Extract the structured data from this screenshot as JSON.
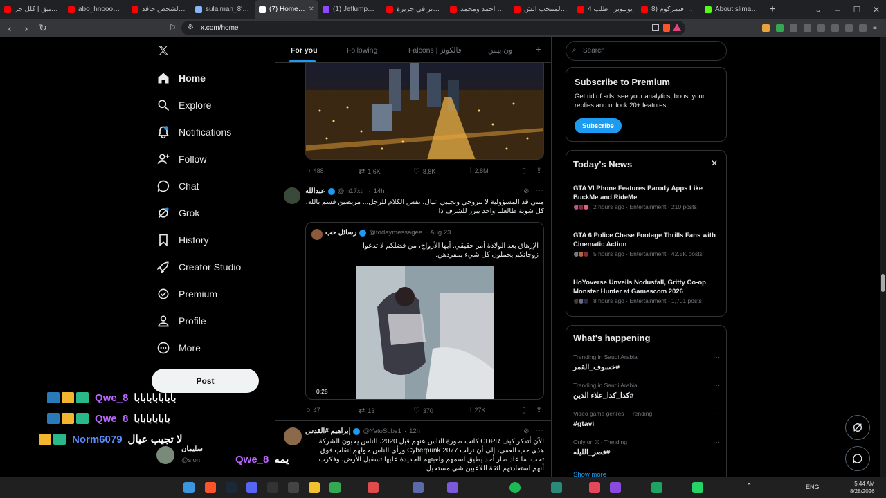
{
  "browser": {
    "tabs": [
      {
        "label": "انيوكستيق | كلل جر",
        "color": "#ff0000",
        "active": false
      },
      {
        "label": "abo_hnoood - Yo",
        "color": "#ff0000",
        "active": false
      },
      {
        "label": "هذا الشخص حاقد",
        "color": "#ff0000",
        "active": false
      },
      {
        "label": "sulaiman_8's Wa",
        "color": "#8ab4f8",
        "active": false
      },
      {
        "label": "(7) Home / X",
        "color": "#ffffff",
        "active": true
      },
      {
        "label": "(1) JeflumpLIVE",
        "color": "#9146ff",
        "active": false
      },
      {
        "label": "فالكونز في جزيرة",
        "color": "#ff0000",
        "active": false
      },
      {
        "label": "بث احمد ومحمد",
        "color": "#ff0000",
        "active": false
      },
      {
        "label": "منارة المنتخب الش",
        "color": "#ff0000",
        "active": false
      },
      {
        "label": "4 يوتيوبر | طلب",
        "color": "#ff0000",
        "active": false
      },
      {
        "label": "عرض فيمركوم (8",
        "color": "#ff0000",
        "active": false
      },
      {
        "label": "About sliman_8",
        "color": "#53fc18",
        "active": false
      }
    ],
    "url": "x.com/home"
  },
  "nav": {
    "items": [
      {
        "label": "Home",
        "icon": "home-icon",
        "bold": true
      },
      {
        "label": "Explore",
        "icon": "search-icon"
      },
      {
        "label": "Notifications",
        "icon": "bell-icon"
      },
      {
        "label": "Follow",
        "icon": "person-add-icon"
      },
      {
        "label": "Chat",
        "icon": "chat-icon"
      },
      {
        "label": "Grok",
        "icon": "grok-icon"
      },
      {
        "label": "History",
        "icon": "bookmark-icon"
      },
      {
        "label": "Creator Studio",
        "icon": "rocket-icon"
      },
      {
        "label": "Premium",
        "icon": "premium-icon"
      },
      {
        "label": "Profile",
        "icon": "person-icon"
      },
      {
        "label": "More",
        "icon": "more-circle-icon"
      }
    ],
    "post_label": "Post"
  },
  "feed": {
    "tabs": [
      "For you",
      "Following",
      "Falcons | فالكونز",
      "ون بيس"
    ],
    "tweet1": {
      "replies": "488",
      "retweets": "1.6K",
      "likes": "8.8K",
      "views": "2.8M"
    },
    "tweet2": {
      "name": "عبدالله",
      "handle": "@m17xtn",
      "time": "14h",
      "text": "متني قد المسؤولية لا تتزوجي وتجيبي عيال، نفس الكلام للرجل... مريضين قسم بالله، كل شوية طالعلنا واحد يبرر للشرف ذا",
      "quote": {
        "name": "رسائل حب",
        "handle": "@todaymessagee",
        "date": "Aug 23",
        "text": "الإرهاق بعد الولادة أمر حقيقي. أيها الأزواج، من فضلكم لا تدعوا زوجاتكم يحملون كل شيء بمفردهن.",
        "duration": "0:28"
      },
      "replies": "47",
      "retweets": "13",
      "likes": "370",
      "views": "27K"
    },
    "tweet3": {
      "name": "إبراهيم #القدس",
      "handle": "@YatoSubs1",
      "time": "12h",
      "text": "الآن أتذكر كيف CDPR كانت صورة الناس عنهم قبل 2020، الناس يحبون الشركة هذي حب العمى، إلى أن نزلت Cyberpunk 2077 ورأي الناس حولهم انقلب فوق تحت، ما عاد صار أحد يطيق اسمهم ولعبتهم الجديدة عليها تسفيل الأرض، وفكرت أنهم استعادتهم لثقة اللاعبين شي مستحيل"
    }
  },
  "search": {
    "placeholder": "Search"
  },
  "premium": {
    "title": "Subscribe to Premium",
    "body": "Get rid of ads, see your analytics, boost your replies and unlock 20+ features.",
    "button": "Subscribe"
  },
  "news": {
    "title": "Today's News",
    "items": [
      {
        "title": "GTA VI Phone Features Parody Apps Like BuckMe and RideMe",
        "meta": "2 hours ago · Entertainment · 210 posts"
      },
      {
        "title": "GTA 6 Police Chase Footage Thrills Fans with Cinematic Action",
        "meta": "5 hours ago · Entertainment · 42.5K posts"
      },
      {
        "title": "HoYoverse Unveils Nodusfall, Gritty Co-op Monster Hunter at Gamescom 2026",
        "meta": "8 hours ago · Entertainment · 1,701 posts"
      }
    ]
  },
  "happening": {
    "title": "What's happening",
    "items": [
      {
        "meta": "Trending in Saudi Arabia",
        "title": "#خسوف_القمر"
      },
      {
        "meta": "Trending in Saudi Arabia",
        "title": "#كدا_كدا_علاء الدين"
      },
      {
        "meta": "Video game genres · Trending",
        "title": "#gtavi"
      },
      {
        "meta": "Only on X · Trending",
        "title": "#قصر_الليله"
      }
    ],
    "show_more": "Show more"
  },
  "stream_chat": [
    {
      "user": "Qwe_8",
      "msg": "بابابابابابابا",
      "color": "#b967ff"
    },
    {
      "user": "Qwe_8",
      "msg": "بابابابابابا",
      "color": "#b967ff"
    },
    {
      "user": "Norm6079",
      "msg": "لا تجيب عيال",
      "color": "#5b8cff"
    },
    {
      "user": "Qwe_8",
      "msg": "يمه",
      "color": "#b967ff"
    }
  ],
  "overlay_user": {
    "name": "سليمان",
    "handle": "@slon"
  },
  "taskbar": {
    "lang": "ENG",
    "time": "5:44 AM",
    "date": "8/28/2026"
  }
}
